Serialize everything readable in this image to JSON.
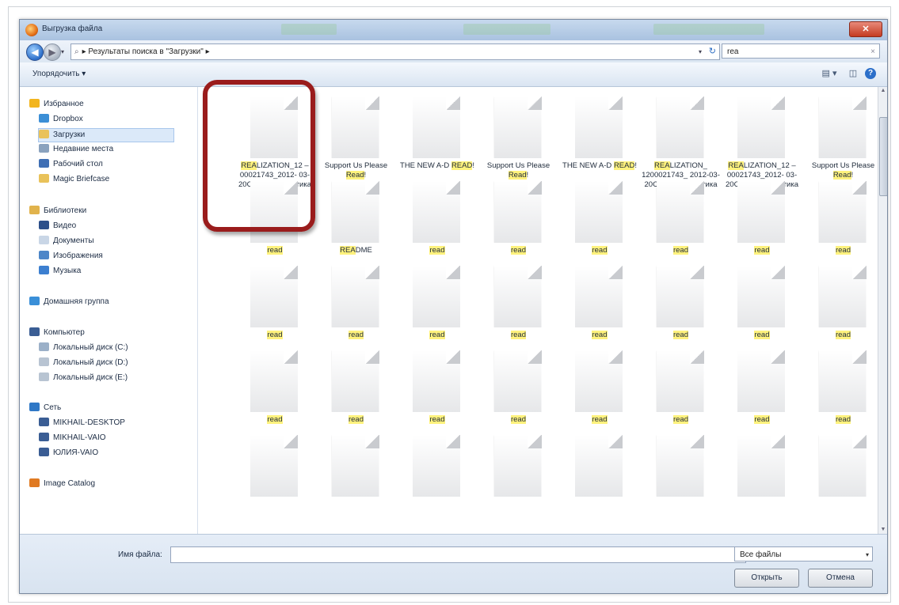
{
  "window": {
    "title": "Выгрузка файла",
    "close": "✕"
  },
  "nav": {
    "back_glyph": "◀",
    "forward_glyph": "▶",
    "dropdown_glyph": "▾",
    "refresh_glyph": "↻"
  },
  "address": {
    "path": "Результаты поиска в \"Загрузки\"",
    "sep1": "▸",
    "sep2": "▸"
  },
  "search": {
    "value": "rea",
    "clear": "×"
  },
  "toolbar": {
    "organize": "Упорядочить ▾",
    "views_glyph": "▤ ▾",
    "preview_glyph": "◫",
    "help_glyph": "?"
  },
  "sidebar": {
    "items": [
      {
        "label": "Избранное",
        "icon": "star-icon",
        "color": "#f2b51e"
      },
      {
        "label": "Dropbox",
        "icon": "dropbox-icon",
        "color": "#3c8fd6"
      },
      {
        "label": "Загрузки",
        "icon": "downloads-folder-icon",
        "color": "#e9c25a"
      },
      {
        "label": "Недавние места",
        "icon": "recent-places-icon",
        "color": "#8aa2be"
      },
      {
        "label": "Рабочий стол",
        "icon": "desktop-icon",
        "color": "#3f6fb4"
      },
      {
        "label": "Magic Briefcase",
        "icon": "briefcase-folder-icon",
        "color": "#e9c25a"
      },
      {
        "label": "Библиотеки",
        "icon": "libraries-icon",
        "color": "#e1b34c"
      },
      {
        "label": "Видео",
        "icon": "video-icon",
        "color": "#2c4f8a"
      },
      {
        "label": "Документы",
        "icon": "documents-icon",
        "color": "#c9d6e6"
      },
      {
        "label": "Изображения",
        "icon": "pictures-icon",
        "color": "#4d86c8"
      },
      {
        "label": "Музыка",
        "icon": "music-icon",
        "color": "#3c7fd0"
      },
      {
        "label": "Домашняя группа",
        "icon": "homegroup-icon",
        "color": "#3a8fd8"
      },
      {
        "label": "Компьютер",
        "icon": "computer-icon",
        "color": "#3a5d94"
      },
      {
        "label": "Локальный диск (C:)",
        "icon": "drive-icon",
        "color": "#9bb0c8"
      },
      {
        "label": "Локальный диск (D:)",
        "icon": "drive-icon",
        "color": "#b8c4d2"
      },
      {
        "label": "Локальный диск (E:)",
        "icon": "drive-icon",
        "color": "#b8c4d2"
      },
      {
        "label": "Сеть",
        "icon": "network-icon",
        "color": "#2f78c6"
      },
      {
        "label": "MIKHAIL-DESKTOP",
        "icon": "network-computer-icon",
        "color": "#3a5d94"
      },
      {
        "label": "MIKHAIL-VAIO",
        "icon": "network-computer-icon",
        "color": "#3a5d94"
      },
      {
        "label": "ЮЛИЯ-VAIO",
        "icon": "network-computer-icon",
        "color": "#3a5d94"
      },
      {
        "label": "Image Catalog",
        "icon": "image-catalog-icon",
        "color": "#e07a22"
      }
    ]
  },
  "files": [
    {
      "pre": "",
      "hl": "REA",
      "post": "LIZATION_12 –00021743_2012- 03-20CB- ИмиджОптика"
    },
    {
      "pre": "Support Us Please ",
      "hl": "Read",
      "post": "!"
    },
    {
      "pre": "THE NEW A-D ",
      "hl": "READ",
      "post": "!"
    },
    {
      "pre": "Support Us Please ",
      "hl": "Read",
      "post": "!"
    },
    {
      "pre": "THE NEW A-D ",
      "hl": "READ",
      "post": "!"
    },
    {
      "pre": "",
      "hl": "REA",
      "post": "LIZATION_ 1200021743_ 2012-03-20CB- ИмиджОптика"
    },
    {
      "pre": "",
      "hl": "REA",
      "post": "LIZATION_12 –00021743_2012- 03-20CB- ИмиджОптика"
    },
    {
      "pre": "Support Us Please ",
      "hl": "Read",
      "post": "!"
    },
    {
      "pre": "",
      "hl": "read",
      "post": ""
    },
    {
      "pre": "",
      "hl": "REA",
      "post": "DME"
    },
    {
      "pre": "",
      "hl": "read",
      "post": ""
    },
    {
      "pre": "",
      "hl": "read",
      "post": ""
    },
    {
      "pre": "",
      "hl": "read",
      "post": ""
    },
    {
      "pre": "",
      "hl": "read",
      "post": ""
    },
    {
      "pre": "",
      "hl": "read",
      "post": ""
    },
    {
      "pre": "",
      "hl": "read",
      "post": ""
    },
    {
      "pre": "",
      "hl": "read",
      "post": ""
    },
    {
      "pre": "",
      "hl": "read",
      "post": ""
    },
    {
      "pre": "",
      "hl": "read",
      "post": ""
    },
    {
      "pre": "",
      "hl": "read",
      "post": ""
    },
    {
      "pre": "",
      "hl": "read",
      "post": ""
    },
    {
      "pre": "",
      "hl": "read",
      "post": ""
    },
    {
      "pre": "",
      "hl": "read",
      "post": ""
    },
    {
      "pre": "",
      "hl": "read",
      "post": ""
    },
    {
      "pre": "",
      "hl": "read",
      "post": ""
    },
    {
      "pre": "",
      "hl": "read",
      "post": ""
    },
    {
      "pre": "",
      "hl": "read",
      "post": ""
    },
    {
      "pre": "",
      "hl": "read",
      "post": ""
    },
    {
      "pre": "",
      "hl": "read",
      "post": ""
    },
    {
      "pre": "",
      "hl": "read",
      "post": ""
    },
    {
      "pre": "",
      "hl": "read",
      "post": ""
    },
    {
      "pre": "",
      "hl": "read",
      "post": ""
    },
    {
      "pre": "",
      "hl": "",
      "post": ""
    },
    {
      "pre": "",
      "hl": "",
      "post": ""
    },
    {
      "pre": "",
      "hl": "",
      "post": ""
    },
    {
      "pre": "",
      "hl": "",
      "post": ""
    },
    {
      "pre": "",
      "hl": "",
      "post": ""
    },
    {
      "pre": "",
      "hl": "",
      "post": ""
    },
    {
      "pre": "",
      "hl": "",
      "post": ""
    },
    {
      "pre": "",
      "hl": "",
      "post": ""
    }
  ],
  "footer": {
    "filename_label": "Имя файла:",
    "filename_value": "",
    "filename_dropdown": "▾",
    "filter_value": "Все файлы",
    "filter_dropdown": "▾",
    "open": "Открыть",
    "cancel": "Отмена"
  },
  "scroll": {
    "up": "▲",
    "down": "▼"
  },
  "colors": {
    "highlight": "#fff27d",
    "annotation_box": "#9a1c1c",
    "selected_nav": "#dbe9f9"
  }
}
